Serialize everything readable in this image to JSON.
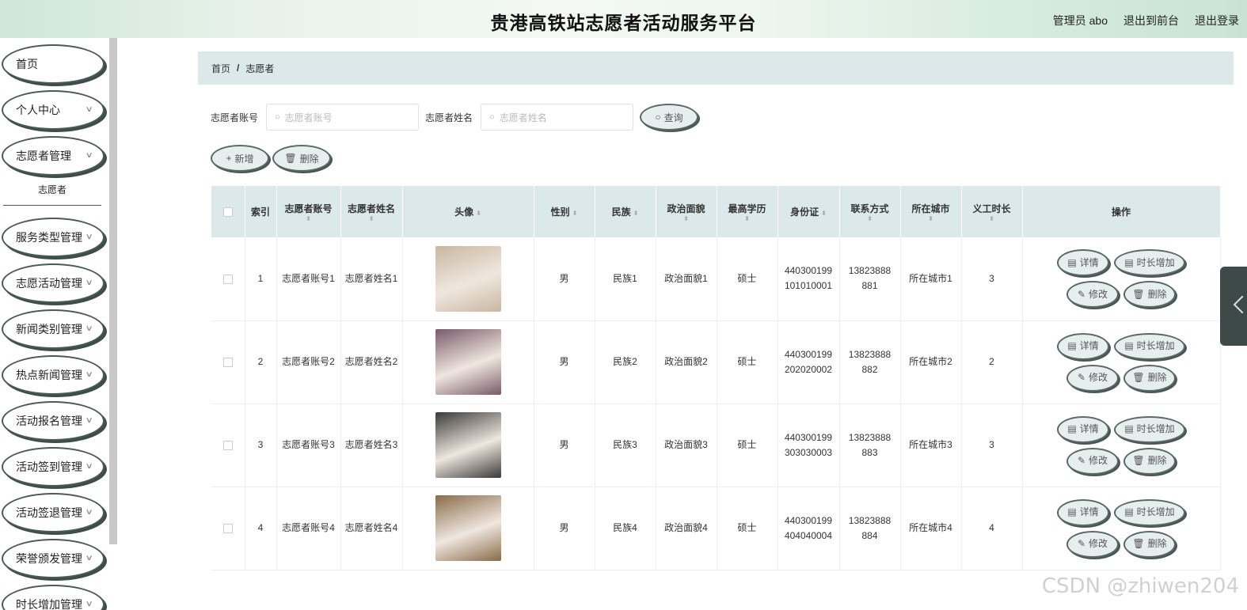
{
  "header": {
    "title": "贵港高铁站志愿者活动服务平台",
    "user": "管理员 abo",
    "front": "退出到前台",
    "logout": "退出登录"
  },
  "sidebar": {
    "items": [
      {
        "label": "首页"
      },
      {
        "label": "个人中心"
      },
      {
        "label": "志愿者管理"
      },
      {
        "label": "服务类型管理"
      },
      {
        "label": "志愿活动管理"
      },
      {
        "label": "新闻类别管理"
      },
      {
        "label": "热点新闻管理"
      },
      {
        "label": "活动报名管理"
      },
      {
        "label": "活动签到管理"
      },
      {
        "label": "活动签退管理"
      },
      {
        "label": "荣誉颁发管理"
      },
      {
        "label": "时长增加管理"
      }
    ],
    "sub_item": "志愿者"
  },
  "breadcrumb": {
    "home": "首页",
    "sep": "/",
    "current": "志愿者"
  },
  "search": {
    "account_label": "志愿者账号",
    "account_placeholder": "志愿者账号",
    "name_label": "志愿者姓名",
    "name_placeholder": "志愿者姓名",
    "query": "查询"
  },
  "actions": {
    "add": "新增",
    "delete": "删除"
  },
  "table": {
    "headers": [
      "索引",
      "志愿者账号",
      "志愿者姓名",
      "头像",
      "性别",
      "民族",
      "政治面貌",
      "最高学历",
      "身份证",
      "联系方式",
      "所在城市",
      "义工时长",
      "操作"
    ],
    "rows": [
      {
        "index": "1",
        "account": "志愿者账号1",
        "name": "志愿者姓名1",
        "gender": "男",
        "ethnic": "民族1",
        "political": "政治面貌1",
        "edu": "硕士",
        "idcard": "440300199101010001",
        "phone": "13823888881",
        "city": "所在城市1",
        "hours": "3"
      },
      {
        "index": "2",
        "account": "志愿者账号2",
        "name": "志愿者姓名2",
        "gender": "男",
        "ethnic": "民族2",
        "political": "政治面貌2",
        "edu": "硕士",
        "idcard": "440300199202020002",
        "phone": "13823888882",
        "city": "所在城市2",
        "hours": "2"
      },
      {
        "index": "3",
        "account": "志愿者账号3",
        "name": "志愿者姓名3",
        "gender": "男",
        "ethnic": "民族3",
        "political": "政治面貌3",
        "edu": "硕士",
        "idcard": "440300199303030003",
        "phone": "13823888883",
        "city": "所在城市3",
        "hours": "3"
      },
      {
        "index": "4",
        "account": "志愿者账号4",
        "name": "志愿者姓名4",
        "gender": "男",
        "ethnic": "民族4",
        "political": "政治面貌4",
        "edu": "硕士",
        "idcard": "440300199404040004",
        "phone": "13823888884",
        "city": "所在城市4",
        "hours": "4"
      }
    ],
    "ops": {
      "detail": "详情",
      "add_hours": "时长增加",
      "edit": "修改",
      "delete": "删除"
    }
  },
  "watermark": "CSDN @zhiwen204"
}
